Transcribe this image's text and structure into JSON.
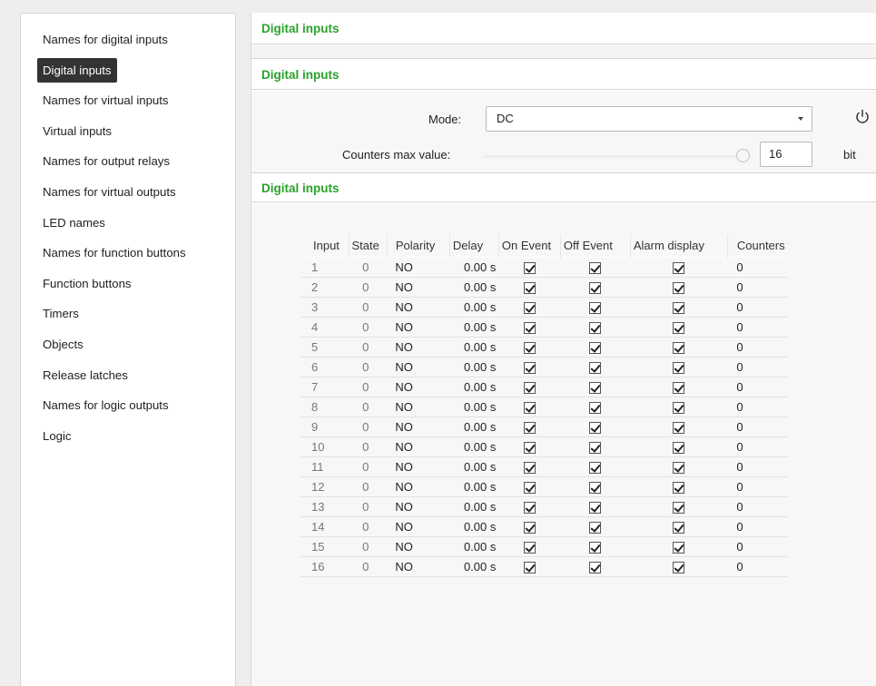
{
  "sidebar": {
    "items": [
      {
        "label": "Names for digital inputs",
        "active": false
      },
      {
        "label": "Digital inputs",
        "active": true
      },
      {
        "label": "Names for virtual inputs",
        "active": false
      },
      {
        "label": "Virtual inputs",
        "active": false
      },
      {
        "label": "Names for output relays",
        "active": false
      },
      {
        "label": "Names for virtual outputs",
        "active": false
      },
      {
        "label": "LED names",
        "active": false
      },
      {
        "label": "Names for function buttons",
        "active": false
      },
      {
        "label": "Function buttons",
        "active": false
      },
      {
        "label": "Timers",
        "active": false
      },
      {
        "label": "Objects",
        "active": false
      },
      {
        "label": "Release latches",
        "active": false
      },
      {
        "label": "Names for logic outputs",
        "active": false
      },
      {
        "label": "Logic",
        "active": false
      }
    ]
  },
  "main": {
    "section1_title": "Digital inputs",
    "section2_title": "Digital inputs",
    "section3_title": "Digital inputs",
    "mode": {
      "label": "Mode:",
      "value": "DC"
    },
    "counters_max": {
      "label": "Counters max value:",
      "value": "16",
      "unit": "bit"
    },
    "table": {
      "headers": [
        "Input",
        "State",
        "Polarity",
        "Delay",
        "On Event",
        "Off Event",
        "Alarm display",
        "Counters"
      ],
      "rows": [
        {
          "input": "1",
          "state": "0",
          "polarity": "NO",
          "delay": "0.00 s",
          "on_event": true,
          "off_event": true,
          "alarm": true,
          "counters": "0"
        },
        {
          "input": "2",
          "state": "0",
          "polarity": "NO",
          "delay": "0.00 s",
          "on_event": true,
          "off_event": true,
          "alarm": true,
          "counters": "0"
        },
        {
          "input": "3",
          "state": "0",
          "polarity": "NO",
          "delay": "0.00 s",
          "on_event": true,
          "off_event": true,
          "alarm": true,
          "counters": "0"
        },
        {
          "input": "4",
          "state": "0",
          "polarity": "NO",
          "delay": "0.00 s",
          "on_event": true,
          "off_event": true,
          "alarm": true,
          "counters": "0"
        },
        {
          "input": "5",
          "state": "0",
          "polarity": "NO",
          "delay": "0.00 s",
          "on_event": true,
          "off_event": true,
          "alarm": true,
          "counters": "0"
        },
        {
          "input": "6",
          "state": "0",
          "polarity": "NO",
          "delay": "0.00 s",
          "on_event": true,
          "off_event": true,
          "alarm": true,
          "counters": "0"
        },
        {
          "input": "7",
          "state": "0",
          "polarity": "NO",
          "delay": "0.00 s",
          "on_event": true,
          "off_event": true,
          "alarm": true,
          "counters": "0"
        },
        {
          "input": "8",
          "state": "0",
          "polarity": "NO",
          "delay": "0.00 s",
          "on_event": true,
          "off_event": true,
          "alarm": true,
          "counters": "0"
        },
        {
          "input": "9",
          "state": "0",
          "polarity": "NO",
          "delay": "0.00 s",
          "on_event": true,
          "off_event": true,
          "alarm": true,
          "counters": "0"
        },
        {
          "input": "10",
          "state": "0",
          "polarity": "NO",
          "delay": "0.00 s",
          "on_event": true,
          "off_event": true,
          "alarm": true,
          "counters": "0"
        },
        {
          "input": "11",
          "state": "0",
          "polarity": "NO",
          "delay": "0.00 s",
          "on_event": true,
          "off_event": true,
          "alarm": true,
          "counters": "0"
        },
        {
          "input": "12",
          "state": "0",
          "polarity": "NO",
          "delay": "0.00 s",
          "on_event": true,
          "off_event": true,
          "alarm": true,
          "counters": "0"
        },
        {
          "input": "13",
          "state": "0",
          "polarity": "NO",
          "delay": "0.00 s",
          "on_event": true,
          "off_event": true,
          "alarm": true,
          "counters": "0"
        },
        {
          "input": "14",
          "state": "0",
          "polarity": "NO",
          "delay": "0.00 s",
          "on_event": true,
          "off_event": true,
          "alarm": true,
          "counters": "0"
        },
        {
          "input": "15",
          "state": "0",
          "polarity": "NO",
          "delay": "0.00 s",
          "on_event": true,
          "off_event": true,
          "alarm": true,
          "counters": "0"
        },
        {
          "input": "16",
          "state": "0",
          "polarity": "NO",
          "delay": "0.00 s",
          "on_event": true,
          "off_event": true,
          "alarm": true,
          "counters": "0"
        }
      ]
    }
  },
  "icons": {
    "power": "power-icon",
    "dropdown": "chevron-down-icon",
    "checkbox": "checkbox-checked-icon"
  },
  "colors": {
    "section_title": "#2aa22a",
    "active_item_bg": "#333333"
  }
}
